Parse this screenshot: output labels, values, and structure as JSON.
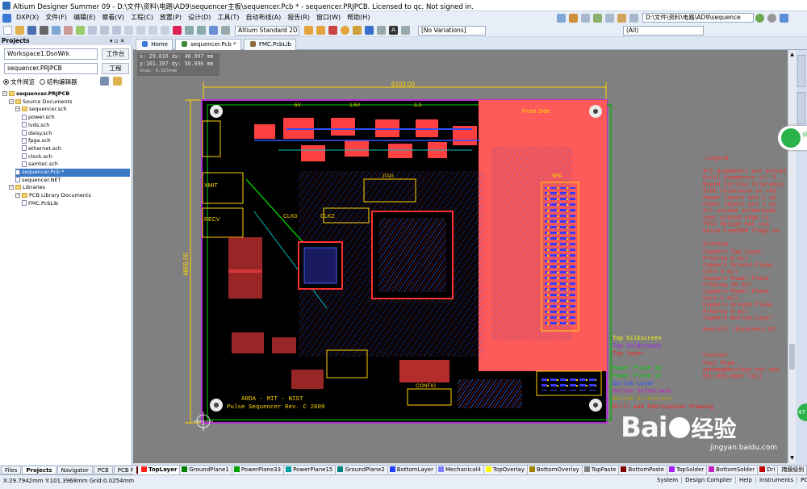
{
  "window": {
    "title": "Altium Designer Summer 09 - D:\\文件\\资料\\电路\\AD9\\sequencer主板\\sequencer.Pcb * - sequencer.PRJPCB. Licensed to qc. Not signed in."
  },
  "menu": [
    "DXP(X)",
    "文件(F)",
    "编辑(E)",
    "察看(V)",
    "工程(C)",
    "放置(P)",
    "设计(D)",
    "工具(T)",
    "自动布线(A)",
    "报告(R)",
    "窗口(W)",
    "帮助(H)"
  ],
  "toolbar": {
    "path_box": "D:\\文件\\资料\\电路\\AD9\\sequence",
    "view_select": "Altium Standard 2D",
    "variations_select": "[No Variations]",
    "filter_select": "(All)"
  },
  "projects_panel": {
    "title": "Projects",
    "workspace": "Workspace1.DsnWrk",
    "workspace_btn": "工作台",
    "project": "sequencer.PRJPCB",
    "project_btn": "工程",
    "radio_file_view": "文件阅览",
    "radio_struct_editor": "结构编辑器",
    "tree": [
      {
        "label": "sequencer.PRJPCB",
        "level": 0,
        "kind": "project",
        "selected": false,
        "bold": true
      },
      {
        "label": "Source Documents",
        "level": 1,
        "kind": "folder"
      },
      {
        "label": "sequencer.sch",
        "level": 2,
        "kind": "folder"
      },
      {
        "label": "power.sch",
        "level": 3,
        "kind": "doc"
      },
      {
        "label": "lvds.sch",
        "level": 3,
        "kind": "doc"
      },
      {
        "label": "daisy.sch",
        "level": 3,
        "kind": "doc"
      },
      {
        "label": "fpga.sch",
        "level": 3,
        "kind": "doc"
      },
      {
        "label": "ethernet.sch",
        "level": 3,
        "kind": "doc"
      },
      {
        "label": "clock.sch",
        "level": 3,
        "kind": "doc"
      },
      {
        "label": "samtec.sch",
        "level": 3,
        "kind": "doc"
      },
      {
        "label": "sequencer.Pcb *",
        "level": 2,
        "kind": "doc",
        "selected": true
      },
      {
        "label": "sequencer.NET",
        "level": 2,
        "kind": "doc"
      },
      {
        "label": "Libraries",
        "level": 1,
        "kind": "folder"
      },
      {
        "label": "PCB Library Documents",
        "level": 2,
        "kind": "folder"
      },
      {
        "label": "FMC.PcbLib",
        "level": 3,
        "kind": "doc"
      }
    ]
  },
  "doc_tabs": [
    {
      "label": "Home",
      "active": false
    },
    {
      "label": "sequencer.Pcb *",
      "active": true
    },
    {
      "label": "FMC.PcbLib",
      "active": false
    }
  ],
  "readout": {
    "line1": "x: 29.616   dx: 48.997 mm",
    "line2": "y:101.397   dy: 56.896 mm",
    "snap": "Snap: 0.0254mm"
  },
  "board": {
    "dim_width": "6103.00",
    "dim_height": "4866.00",
    "labels": {
      "front_side": "Front Side",
      "spa": "SPA",
      "xmit": "XMIT",
      "recv": "RECV",
      "clk0": "CLK0",
      "clk2": "CLK2",
      "v5": "5V",
      "v15": "1.5V",
      "v33": "3.3",
      "jtag": "JTAG",
      "config": "CONFIG",
      "title1": "ARDA - MIT - NIST",
      "title2": "Pulse Sequencer  Rev. C  2009"
    }
  },
  "notes": {
    "legend_title": ".Legend",
    "legend_lines": [
      "All diameters are actual",
      "Drill diameters +/- 3",
      "Board outline tolerance",
      "Slot tolerance as req",
      "Power layers are 1 oz",
      "Power layers are 1 oz",
      "All unused solderpads",
      "  near plated edge is",
      "This design has via",
      "which FreeDFM flags as"
    ],
    "stackup_title": "Stackup",
    "stackup_lines": [
      "Coppers Top Layer",
      "    Prepreg 8 mil",
      "Coppers Ground Plane",
      "    Core 5 mil",
      "Coppers Power Plane",
      "    Prepreg 28 mil",
      "Coppers Power Plane",
      "    Core 5 mil",
      "Coppers Ground Plane",
      "    Prepreg 8 mil",
      "Coppers Bottom Layer"
    ],
    "thickness": "Overall thickness 62",
    "contact_title": "Contact",
    "contact_lines": [
      "  Paul Pham",
      "  pphamg@biology.mit.edu",
      "  857-891-6937 cell"
    ],
    "layer_legend": [
      {
        "label": "Top Silkscreen",
        "color": "#ffff00"
      },
      {
        "label": "Top Soldermask",
        "color": "#a020f0"
      },
      {
        "label": "Top Layer",
        "color": "#ff2020"
      },
      {
        "label": "Power Plane 33",
        "color": "#00cc00"
      },
      {
        "label": "Power Plane 15",
        "color": "#00cc00"
      },
      {
        "label": "Bottom Layer",
        "color": "#3050ff"
      },
      {
        "label": "Bottom Soldermask",
        "color": "#c020c0"
      },
      {
        "label": "Bottom Silkscreen",
        "color": "#b0a000"
      },
      {
        "label": "Drill and Fabrication Drawing",
        "color": "#ff2020"
      }
    ]
  },
  "panel_tabs": [
    "Files",
    "Projects",
    "Navigator",
    "PCB",
    "PCB F"
  ],
  "layer_tabs": [
    {
      "label": "TopLayer",
      "color": "#ff2020",
      "active": true
    },
    {
      "label": "GroundPlane1",
      "color": "#008000"
    },
    {
      "label": "PowerPlane33",
      "color": "#00a000"
    },
    {
      "label": "PowerPlane15",
      "color": "#00a0a0"
    },
    {
      "label": "GroundPlane2",
      "color": "#008080"
    },
    {
      "label": "BottomLayer",
      "color": "#2040ff"
    },
    {
      "label": "Mechanical4",
      "color": "#8080ff"
    },
    {
      "label": "TopOverlay",
      "color": "#ffff00"
    },
    {
      "label": "BottomOverlay",
      "color": "#a08000"
    },
    {
      "label": "TopPaste",
      "color": "#808080"
    },
    {
      "label": "BottomPaste",
      "color": "#800000"
    },
    {
      "label": "TopSolder",
      "color": "#a020f0"
    },
    {
      "label": "BottomSolder",
      "color": "#c020c0"
    },
    {
      "label": "Dri",
      "color": "#c00000"
    }
  ],
  "layer_tabs_extra": "掩膜级别",
  "layer_clear": "清除",
  "status": {
    "coords": "X:29.7942mm Y:101.3968mm    Grid:0.0254mm",
    "buttons": [
      "System",
      "Design Compiler",
      "Help",
      "Instruments",
      "PCB"
    ]
  },
  "watermark": {
    "brand": "Bai",
    "brand_tail": "经验",
    "url": "jingyan.baidu.com"
  },
  "floating": {
    "badge": "47",
    "chat": "讯"
  }
}
